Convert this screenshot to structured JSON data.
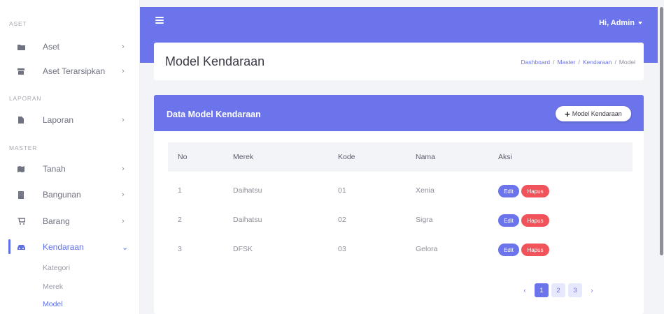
{
  "sidebar": {
    "sections": {
      "aset": "ASET",
      "laporan": "LAPORAN",
      "master": "MASTER"
    },
    "items": {
      "aset": {
        "label": "Aset",
        "icon": "folder-icon"
      },
      "aset_terarsipkan": {
        "label": "Aset Terarsipkan",
        "icon": "archive-icon"
      },
      "laporan": {
        "label": "Laporan",
        "icon": "file-icon"
      },
      "tanah": {
        "label": "Tanah",
        "icon": "map-icon"
      },
      "bangunan": {
        "label": "Bangunan",
        "icon": "building-icon"
      },
      "barang": {
        "label": "Barang",
        "icon": "cart-icon"
      },
      "kendaraan": {
        "label": "Kendaraan",
        "icon": "car-icon"
      }
    },
    "subitems": {
      "kategori": "Kategori",
      "merek": "Merek",
      "model": "Model"
    }
  },
  "topbar": {
    "user_greeting": "Hi, Admin"
  },
  "header": {
    "title": "Model Kendaraan",
    "breadcrumb": [
      "Dashboard",
      "Master",
      "Kendaraan",
      "Model"
    ]
  },
  "card": {
    "title": "Data Model Kendaraan",
    "add_button": "Model Kendaraan"
  },
  "table": {
    "columns": [
      "No",
      "Merek",
      "Kode",
      "Nama",
      "Aksi"
    ],
    "rows": [
      {
        "no": "1",
        "merek": "Daihatsu",
        "kode": "01",
        "nama": "Xenia"
      },
      {
        "no": "2",
        "merek": "Daihatsu",
        "kode": "02",
        "nama": "Sigra"
      },
      {
        "no": "3",
        "merek": "DFSK",
        "kode": "03",
        "nama": "Gelora"
      }
    ],
    "actions": {
      "edit": "Edit",
      "delete": "Hapus"
    }
  },
  "pagination": {
    "prev": "‹",
    "pages": [
      "1",
      "2",
      "3"
    ],
    "current": "1",
    "next": "›"
  },
  "colors": {
    "primary": "#6b74ea",
    "danger": "#f0545a",
    "active_text": "#5f6fe6"
  }
}
